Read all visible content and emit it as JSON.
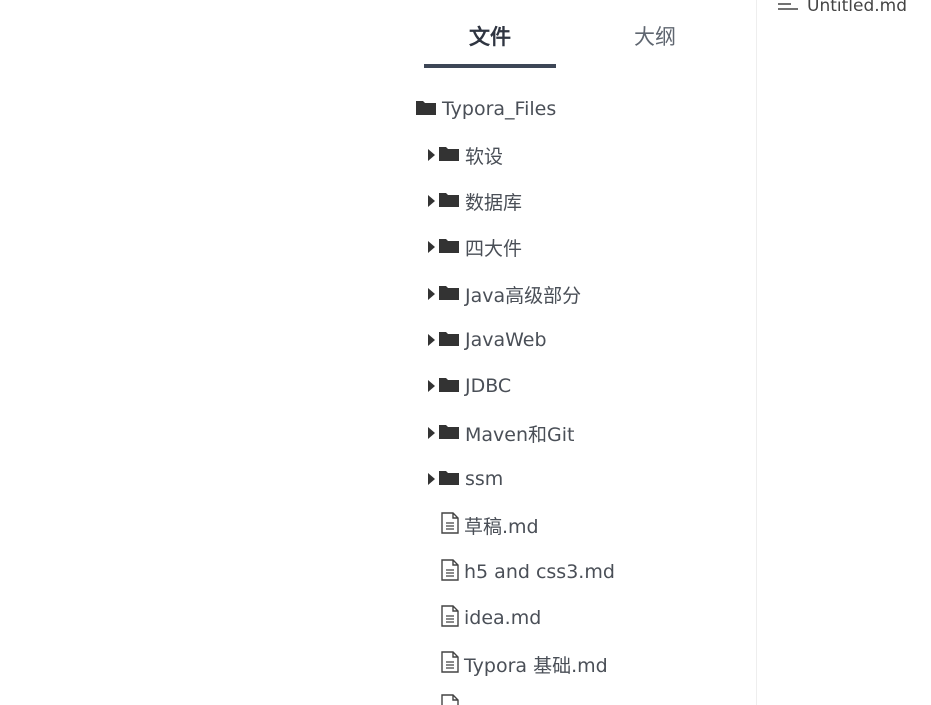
{
  "tabs": {
    "files": "文件",
    "outline": "大纲"
  },
  "root": {
    "label": "Typora_Files"
  },
  "folders": [
    {
      "label": "软设"
    },
    {
      "label": "数据库"
    },
    {
      "label": "四大件"
    },
    {
      "label": "Java高级部分"
    },
    {
      "label": "JavaWeb"
    },
    {
      "label": "JDBC"
    },
    {
      "label": "Maven和Git"
    },
    {
      "label": "ssm"
    }
  ],
  "files": [
    {
      "label": "草稿.md"
    },
    {
      "label": "h5 and css3.md"
    },
    {
      "label": "idea.md"
    },
    {
      "label": "Typora 基础.md"
    }
  ],
  "open_file": {
    "label": "Untitled.md"
  },
  "colors": {
    "accent": "#3d4656",
    "text": "#4a4f57",
    "divider": "#eeeeee"
  }
}
